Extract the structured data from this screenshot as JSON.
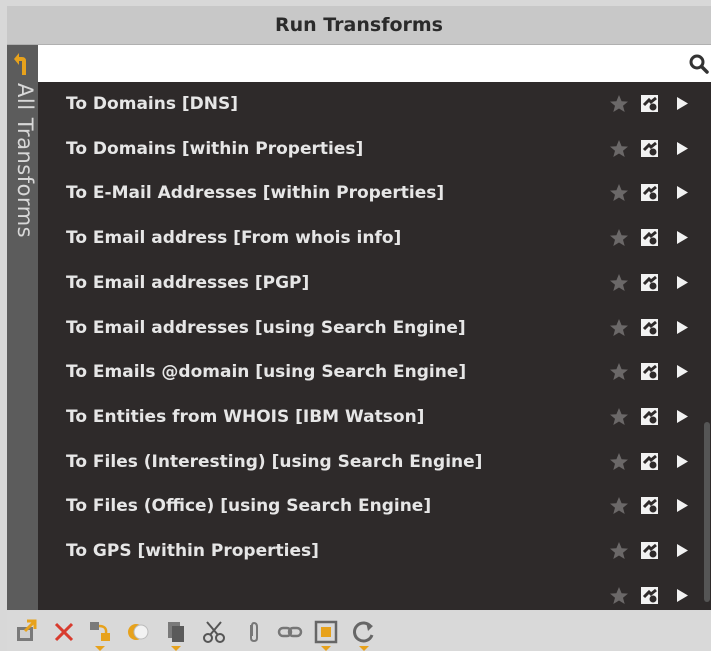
{
  "window": {
    "title": "Run Transforms"
  },
  "sidebar": {
    "label": "All Transforms"
  },
  "search": {
    "value": "",
    "placeholder": ""
  },
  "transforms": [
    {
      "label": "To Domains [DNS]"
    },
    {
      "label": "To Domains [within Properties]"
    },
    {
      "label": "To E-Mail Addresses [within Properties]"
    },
    {
      "label": "To Email address [From whois info]"
    },
    {
      "label": "To Email addresses [PGP]"
    },
    {
      "label": "To Email addresses [using Search Engine]"
    },
    {
      "label": "To Emails @domain [using Search Engine]"
    },
    {
      "label": "To Entities from WHOIS [IBM Watson]"
    },
    {
      "label": "To Files (Interesting) [using Search Engine]"
    },
    {
      "label": "To Files (Office) [using Search Engine]"
    },
    {
      "label": "To GPS [within Properties]"
    },
    {
      "label": ""
    }
  ],
  "row_icons": [
    "star-icon",
    "settings-icon",
    "run-icon"
  ],
  "toolbar_icons": [
    "export-graph-icon",
    "delete-icon",
    "merge-icon",
    "toggle-icon",
    "copy-icon",
    "cut-icon",
    "attach-icon",
    "link-icon",
    "frame-icon",
    "refresh-icon"
  ],
  "colors": {
    "list_bg": "#2e2a2a",
    "row_text": "#e6e6e6",
    "accent": "#e7a21c",
    "delete_red": "#d83b2e"
  }
}
